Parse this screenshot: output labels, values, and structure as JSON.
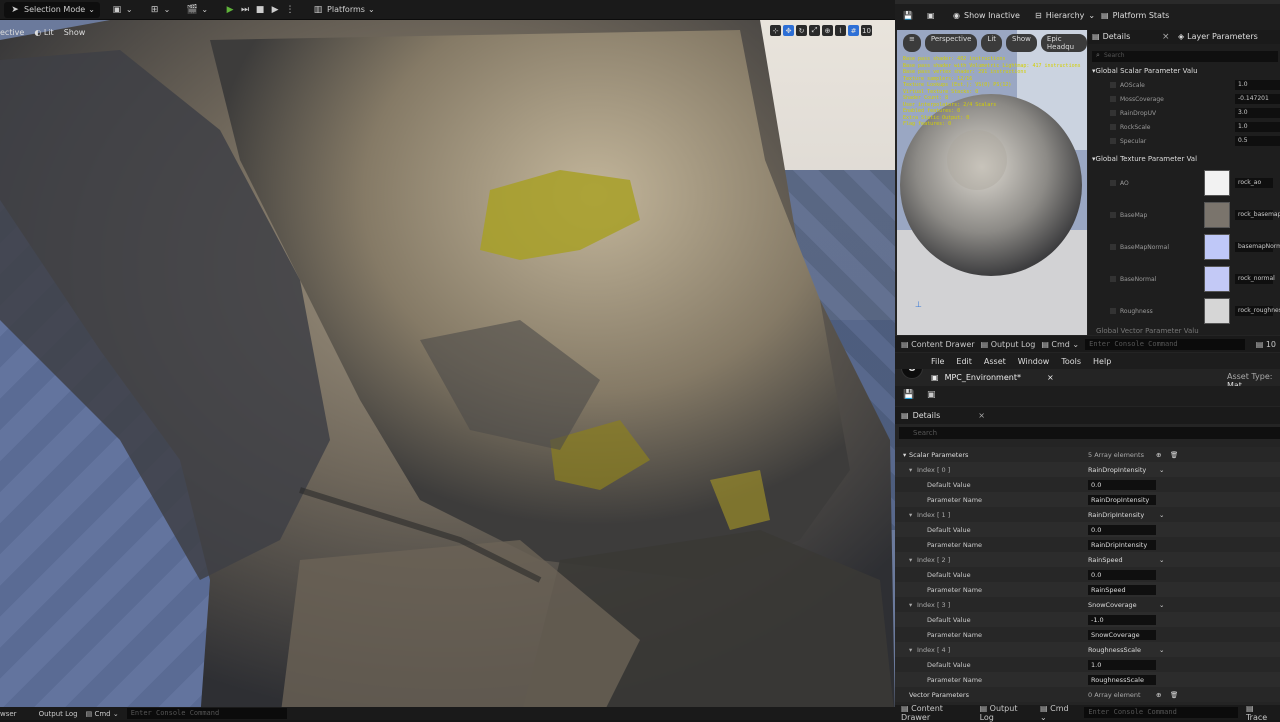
{
  "toolbar": {
    "selection_mode": "Selection Mode",
    "platforms": "Platforms"
  },
  "viewport": {
    "perspective": "ective",
    "lit": "Lit",
    "show": "Show",
    "bottom": {
      "browser": "wser",
      "output_log": "Output Log",
      "cmd": "Cmd",
      "console_placeholder": "Enter Console Command"
    }
  },
  "material_editor": {
    "show_inactive": "Show Inactive",
    "hierarchy": "Hierarchy",
    "platform_stats": "Platform Stats",
    "details_tab": "Details",
    "layer_params_tab": "Layer Parameters",
    "search_placeholder": "Search",
    "preview": {
      "perspective": "Perspective",
      "lit": "Lit",
      "show": "Show",
      "epic": "Epic Headqu",
      "stats": [
        "Base pass shader: 402 instructions",
        "Base pass shader with Volumetric Lightmap: 417 instructions",
        "Base pass vertex shader: 291 instructions",
        "Texture samplers: 12/16",
        "Texture Lookups (Est.): VS(0) PS(12)",
        "Virtual Texture Stacks: 0",
        "Shader Count: 8",
        "User interpolators: 2/4 Scalars",
        "Enabled features: 0",
        "Extra Static Output: 0",
        "Flag features: 0"
      ]
    },
    "global_scalar_section": "Global Scalar Parameter Valu",
    "scalar_params": [
      {
        "name": "AOScale",
        "value": "1.0"
      },
      {
        "name": "MossCoverage",
        "value": "-0.147201"
      },
      {
        "name": "RainDropUV",
        "value": "3.0"
      },
      {
        "name": "RockScale",
        "value": "1.0"
      },
      {
        "name": "Specular",
        "value": "0.5"
      }
    ],
    "global_texture_section": "Global Texture Parameter Val",
    "texture_params": [
      {
        "name": "AO",
        "value": "rock_ao",
        "color": "#f2f2f2"
      },
      {
        "name": "BaseMap",
        "value": "rock_basemap",
        "color": "#7a746c"
      },
      {
        "name": "BaseMapNormal",
        "value": "basemapNormal",
        "color": "#bfc8f8"
      },
      {
        "name": "BaseNormal",
        "value": "rock_normal",
        "color": "#c3c9f6"
      },
      {
        "name": "Roughness",
        "value": "rock_roughness",
        "color": "#d6d6d6"
      }
    ],
    "global_vector_section": "Global Vector Parameter Valu"
  },
  "content_bar": {
    "content_drawer": "Content Drawer",
    "output_log": "Output Log",
    "cmd": "Cmd",
    "console_placeholder": "Enter Console Command",
    "right": "10"
  },
  "asset_editor": {
    "menus": [
      "File",
      "Edit",
      "Asset",
      "Window",
      "Tools",
      "Help"
    ],
    "tab_title": "MPC_Environment*",
    "asset_type_label": "Asset Type:",
    "asset_type_value": "Mat",
    "details_tab": "Details",
    "search_placeholder": "Search",
    "scalar_parameters": "Scalar Parameters",
    "scalar_count": "5 Array elements",
    "entries": [
      {
        "index": "Index [ 0 ]",
        "combo": "RainDropIntensity",
        "default_label": "Default Value",
        "default_value": "0.0",
        "name_label": "Parameter Name",
        "name_value": "RainDropIntensity"
      },
      {
        "index": "Index [ 1 ]",
        "combo": "RainDripIntensity",
        "default_label": "Default Value",
        "default_value": "0.0",
        "name_label": "Parameter Name",
        "name_value": "RainDripIntensity"
      },
      {
        "index": "Index [ 2 ]",
        "combo": "RainSpeed",
        "default_label": "Default Value",
        "default_value": "0.0",
        "name_label": "Parameter Name",
        "name_value": "RainSpeed"
      },
      {
        "index": "Index [ 3 ]",
        "combo": "SnowCoverage",
        "default_label": "Default Value",
        "default_value": "-1.0",
        "name_label": "Parameter Name",
        "name_value": "SnowCoverage"
      },
      {
        "index": "Index [ 4 ]",
        "combo": "RoughnessScale",
        "default_label": "Default Value",
        "default_value": "1.0",
        "name_label": "Parameter Name",
        "name_value": "RoughnessScale"
      }
    ],
    "vector_parameters": "Vector Parameters",
    "vector_count": "0 Array element"
  },
  "bottom_bar": {
    "content_drawer": "Content Drawer",
    "output_log": "Output Log",
    "cmd": "Cmd",
    "console_placeholder": "Enter Console Command",
    "right": "Trace"
  }
}
